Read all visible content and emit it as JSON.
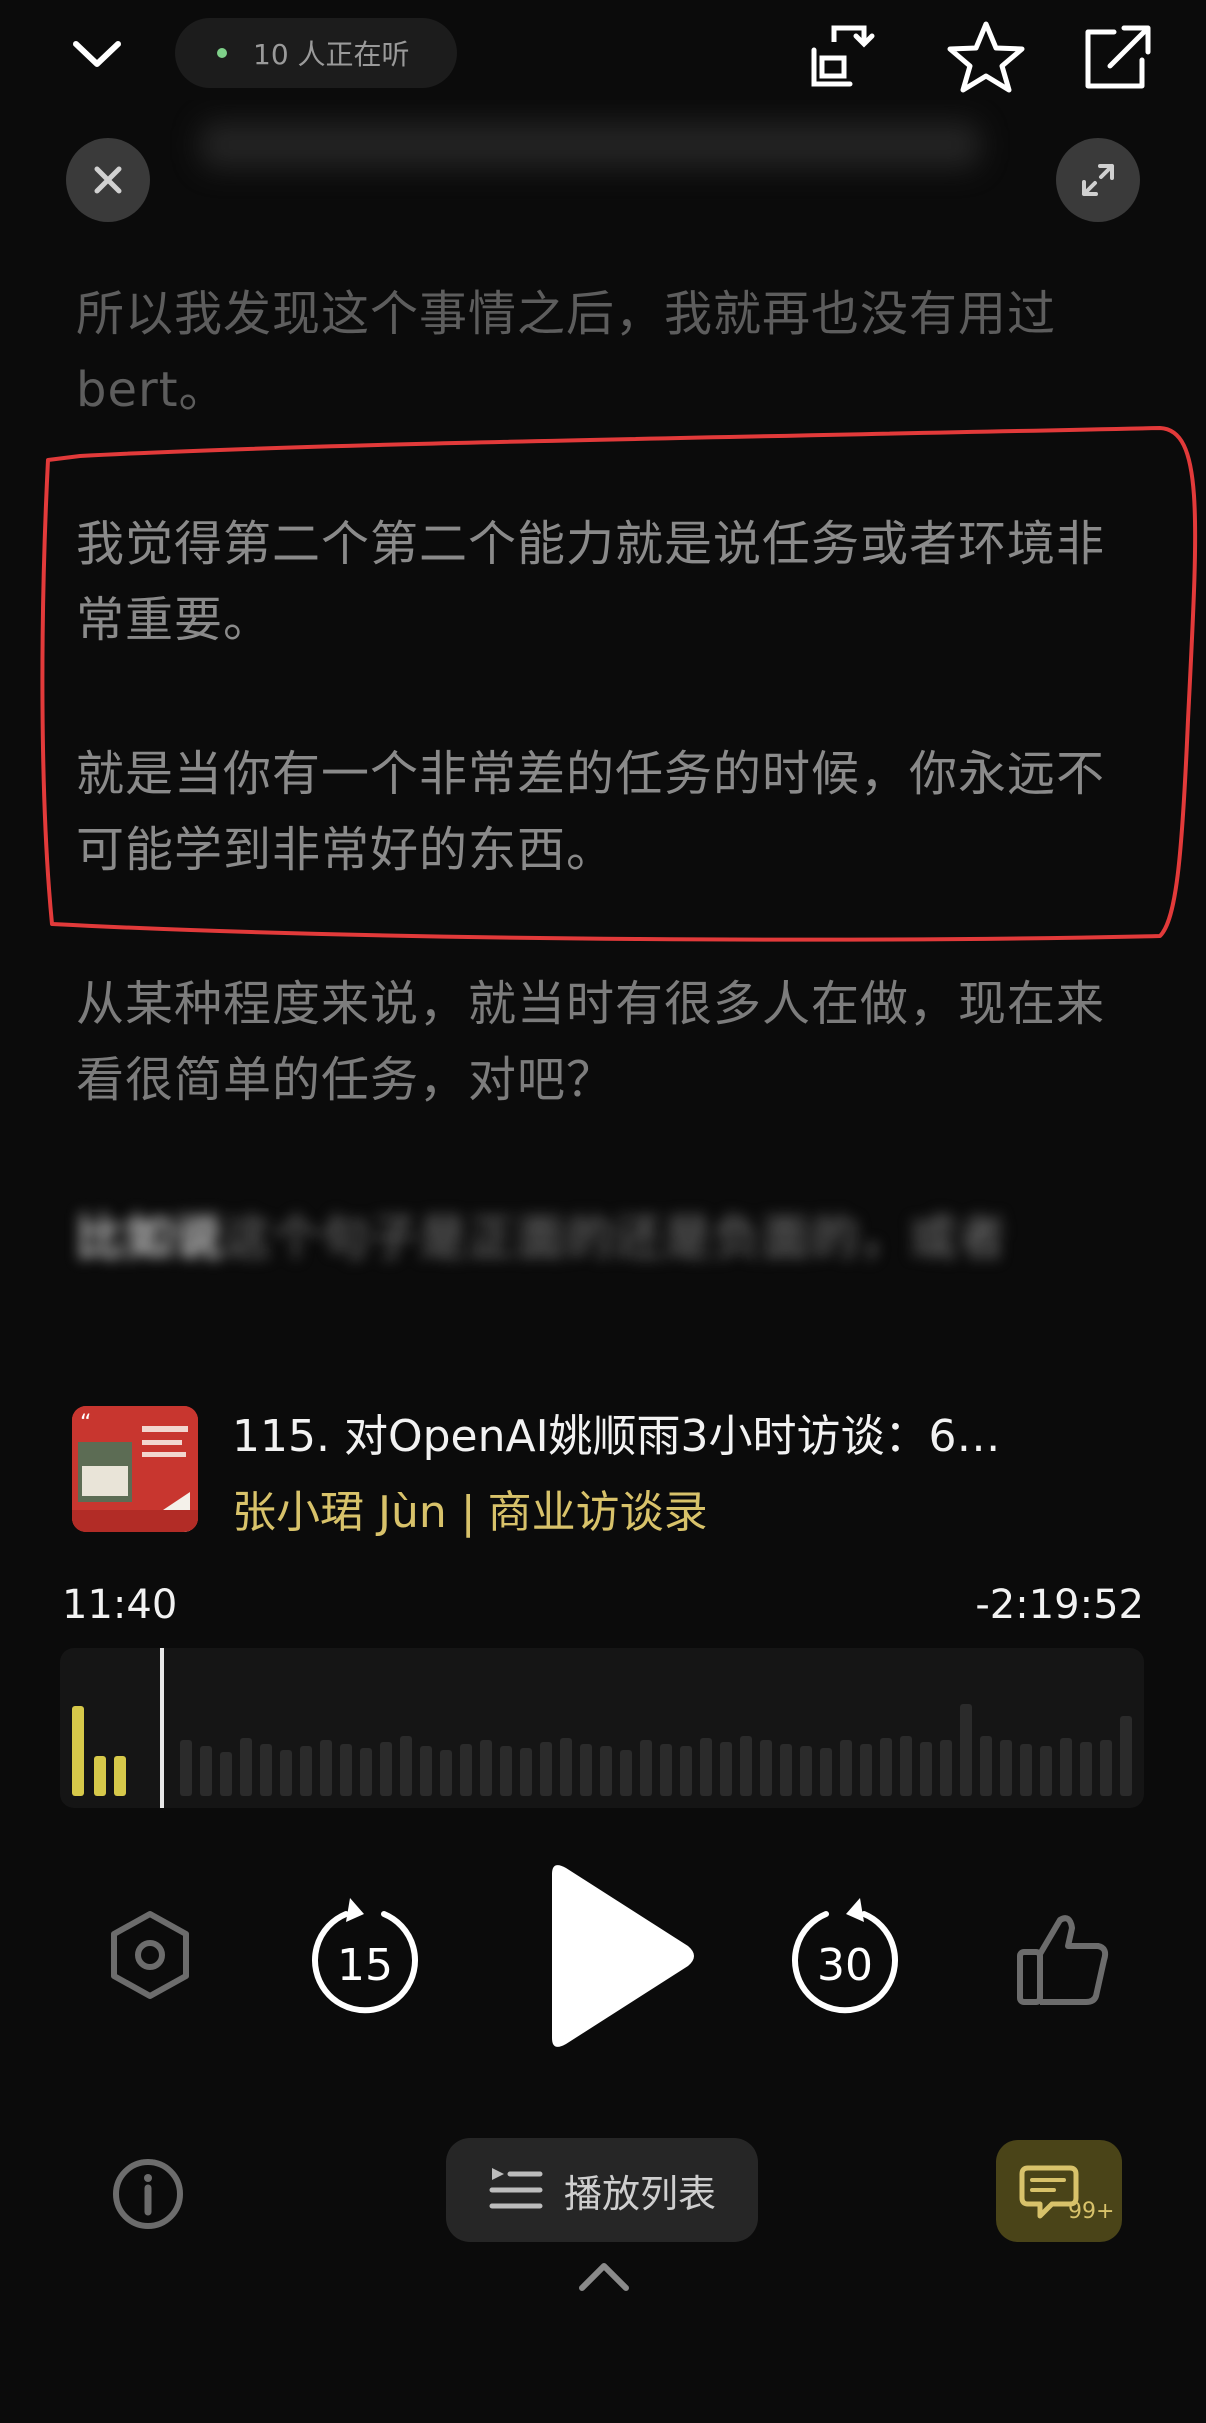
{
  "top_bar": {
    "listeners": "10 人正在听",
    "icons": [
      "chevron-down-icon",
      "share-clip-icon",
      "star-icon",
      "export-icon"
    ]
  },
  "transcript": {
    "partial_top": "所以我发现这个事情之后，我就再也没有用过 bert。",
    "paragraphs": [
      "我觉得第二个第二个能力就是说任务或者环境非常重要。",
      "就是当你有一个非常差的任务的时候，你永远不可能学到非常好的东西。",
      "从某种程度来说，就当时有很多人在做，现在来看很简单的任务，对吧？"
    ],
    "blurred_lead": "比如说",
    "blurred_rest": "这个句子是正面的还是负面的，或者",
    "highlight_color": "#e23a3a"
  },
  "episode": {
    "title": "115. 对OpenAI姚顺雨3小时访谈：6…",
    "host": "张小珺 Jùn",
    "separator": "|",
    "show": "商业访谈录"
  },
  "progress": {
    "elapsed": "11:40",
    "remaining": "-2:19:52",
    "played_color": "#d6c84a"
  },
  "controls": {
    "rewind_seconds": "15",
    "forward_seconds": "30"
  },
  "bottom": {
    "playlist_label": "播放列表",
    "comments_badge": "99+"
  },
  "colors": {
    "background": "#0b0b0b",
    "accent_gold": "#d8c26a"
  }
}
